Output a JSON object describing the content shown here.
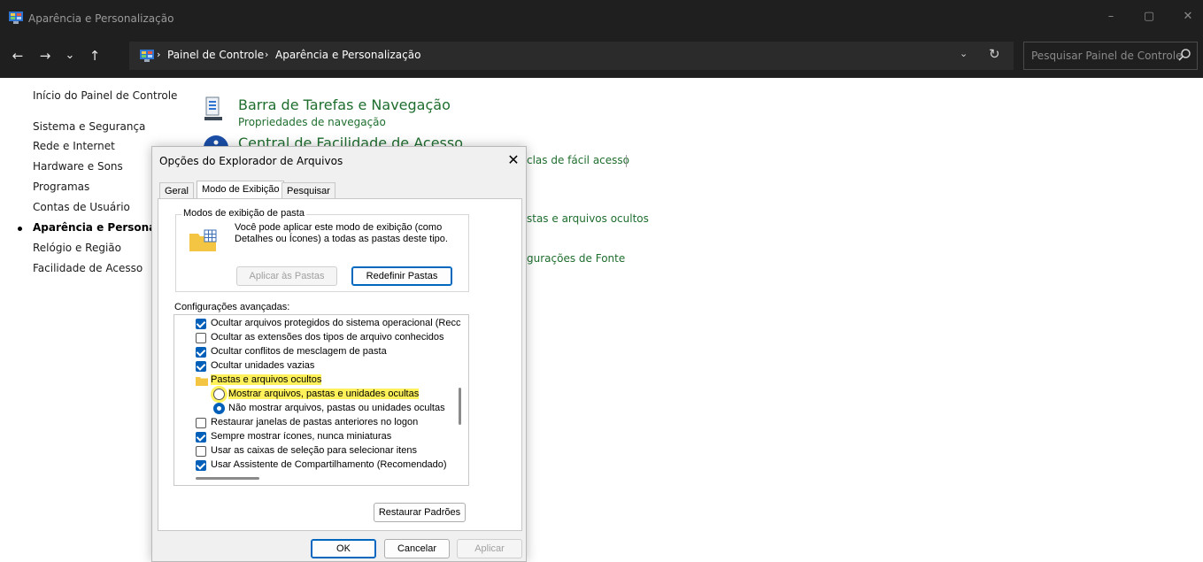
{
  "window": {
    "title": "Aparência e Personalização",
    "controls": {
      "minimize": "–",
      "maximize": "▢",
      "close": "✕"
    }
  },
  "nav": {
    "back": "←",
    "forward": "→",
    "recent": "⌄",
    "up": "↑",
    "breadcrumb": [
      "Painel de Controle",
      "Aparência e Personalização"
    ],
    "separator": "›",
    "dropdown": "⌄",
    "refresh": "↻",
    "search_placeholder": "Pesquisar Painel de Controle"
  },
  "sidebar": {
    "items": [
      "Início do Painel de Controle",
      "Sistema e Segurança",
      "Rede e Internet",
      "Hardware e Sons",
      "Programas",
      "Contas de Usuário",
      "Aparência e Personalização",
      "Relógio e Região",
      "Facilidade de Acesso"
    ],
    "active": "Aparência e Personalização"
  },
  "content": {
    "taskbar_title": "Barra de Tarefas e Navegação",
    "taskbar_link": "Propriedades de navegação",
    "ease_title": "Central de Facilidade de Acesso",
    "partial_link_1": "clas de fácil acesso",
    "partial_link_2": "stas e arquivos ocultos",
    "partial_link_3": "gurações de Fonte"
  },
  "dialog": {
    "title": "Opções do Explorador de Arquivos",
    "close": "✕",
    "tabs": [
      "Geral",
      "Modo de Exibição",
      "Pesquisar"
    ],
    "selected_tab": "Modo de Exibição",
    "folder_views": {
      "label": "Modos de exibição de pasta",
      "description_line1": "Você pode aplicar este modo de exibição (como",
      "description_line2": "Detalhes ou Ícones) a todas as pastas deste tipo.",
      "apply_button": "Aplicar às Pastas",
      "reset_button": "Redefinir Pastas"
    },
    "advanced": {
      "label": "Configurações avançadas:",
      "items": [
        {
          "type": "checkbox",
          "checked": true,
          "indent": 1,
          "label": "Ocultar arquivos protegidos do sistema operacional (Recc"
        },
        {
          "type": "checkbox",
          "checked": false,
          "indent": 1,
          "label": "Ocultar as extensões dos tipos de arquivo conhecidos"
        },
        {
          "type": "checkbox",
          "checked": true,
          "indent": 1,
          "label": "Ocultar conflitos de mesclagem de pasta"
        },
        {
          "type": "checkbox",
          "checked": true,
          "indent": 1,
          "label": "Ocultar unidades vazias"
        },
        {
          "type": "folder",
          "indent": 1,
          "label": "Pastas e arquivos ocultos",
          "highlight": true
        },
        {
          "type": "radio",
          "checked": false,
          "indent": 2,
          "label": "Mostrar arquivos, pastas e unidades ocultas",
          "highlight": true
        },
        {
          "type": "radio",
          "checked": true,
          "indent": 2,
          "label": "Não mostrar arquivos, pastas ou unidades ocultas"
        },
        {
          "type": "checkbox",
          "checked": false,
          "indent": 1,
          "label": "Restaurar janelas de pastas anteriores no logon"
        },
        {
          "type": "checkbox",
          "checked": true,
          "indent": 1,
          "label": "Sempre mostrar ícones, nunca miniaturas"
        },
        {
          "type": "checkbox",
          "checked": false,
          "indent": 1,
          "label": "Usar as caixas de seleção para selecionar itens"
        },
        {
          "type": "checkbox",
          "checked": true,
          "indent": 1,
          "label": "Usar Assistente de Compartilhamento (Recomendado)"
        }
      ]
    },
    "restore_defaults": "Restaurar Padrões",
    "ok": "OK",
    "cancel": "Cancelar",
    "apply": "Aplicar"
  },
  "colors": {
    "titlebar": "#1f1f1f",
    "link_green": "#1e6e2e",
    "accent": "#005fb8",
    "highlight": "#fff15a"
  }
}
